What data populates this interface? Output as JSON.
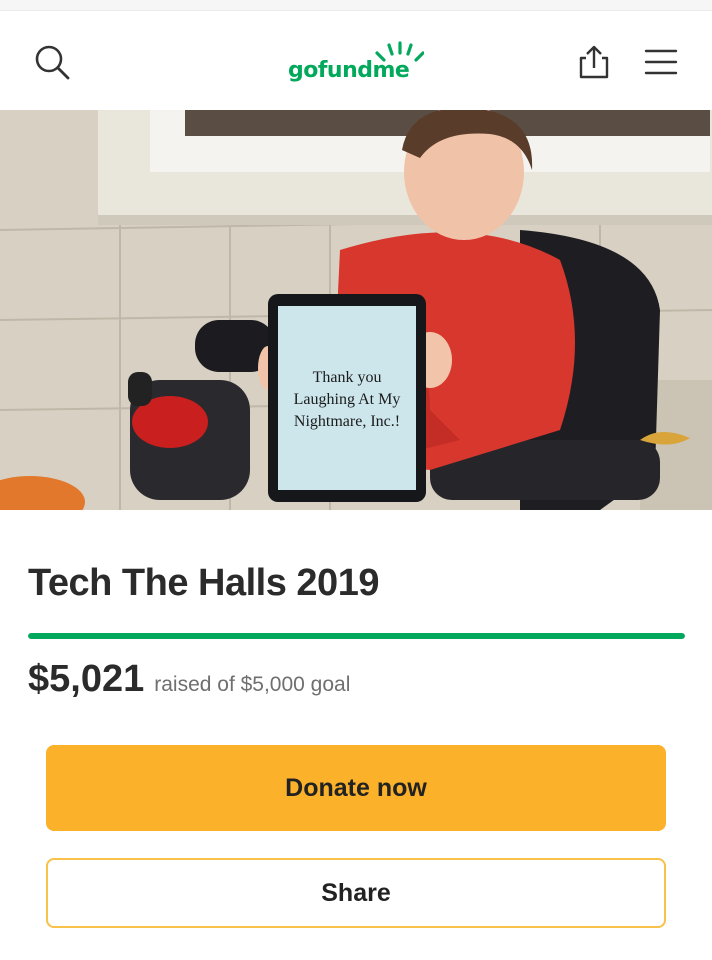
{
  "header": {
    "logo_text": "gofundme",
    "brand_color": "#02a95c"
  },
  "hero": {
    "sign_lines": [
      "Thank you",
      "Laughing At My",
      "Nightmare, Inc.!"
    ]
  },
  "campaign": {
    "title": "Tech The Halls 2019",
    "raised_amount": "$5,021",
    "raised_text": "raised of $5,000 goal",
    "progress_fraction": 1.0,
    "progress_color": "#02a95c"
  },
  "actions": {
    "donate_label": "Donate now",
    "donate_color": "#fbb129",
    "share_label": "Share"
  },
  "icons": [
    "search-icon",
    "share-upload-icon",
    "menu-icon"
  ]
}
